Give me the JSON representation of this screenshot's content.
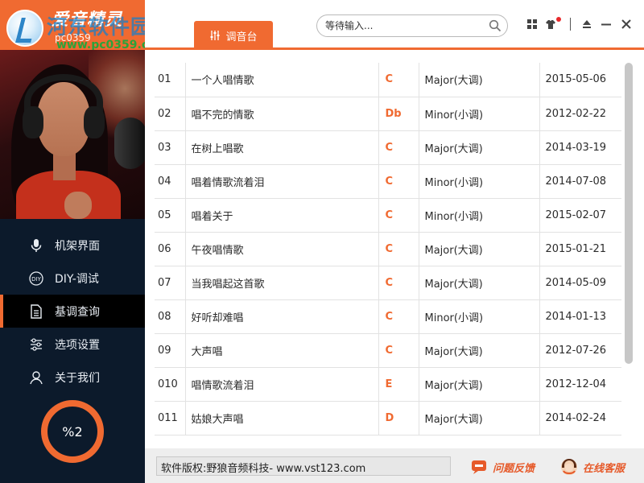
{
  "app": {
    "name": "爱音精灵",
    "watermark_title": "河东软件园",
    "watermark_code": "pc0359",
    "watermark_url": "www.pc0359.cn"
  },
  "sidebar": {
    "items": [
      {
        "label": "机架界面",
        "icon": "microphone-icon"
      },
      {
        "label": "DIY-调试",
        "icon": "diy-icon"
      },
      {
        "label": "基调查询",
        "icon": "document-icon",
        "active": true
      },
      {
        "label": "选项设置",
        "icon": "sliders-icon"
      },
      {
        "label": "关于我们",
        "icon": "user-icon"
      }
    ],
    "progress": {
      "text": "%2",
      "value": 0.02
    }
  },
  "header": {
    "tab": {
      "label": "调音台",
      "icon": "sliders-icon"
    },
    "search": {
      "placeholder": "等待输入...",
      "value": ""
    },
    "controls": [
      "grid-icon",
      "skin-icon",
      "eject-icon",
      "minimize-icon",
      "close-icon"
    ]
  },
  "songs": [
    {
      "num": "01",
      "title": "一个人唱情歌",
      "key": "C",
      "mode": "Major(大调)",
      "date": "2015-05-06"
    },
    {
      "num": "02",
      "title": "唱不完的情歌",
      "key": "Db",
      "mode": "Minor(小调)",
      "date": "2012-02-22"
    },
    {
      "num": "03",
      "title": "在树上唱歌",
      "key": "C",
      "mode": "Major(大调)",
      "date": "2014-03-19"
    },
    {
      "num": "04",
      "title": "唱着情歌流着泪",
      "key": "C",
      "mode": "Minor(小调)",
      "date": "2014-07-08"
    },
    {
      "num": "05",
      "title": "唱着关于",
      "key": "C",
      "mode": "Minor(小调)",
      "date": "2015-02-07"
    },
    {
      "num": "06",
      "title": "午夜唱情歌",
      "key": "C",
      "mode": "Major(大调)",
      "date": "2015-01-21"
    },
    {
      "num": "07",
      "title": "当我唱起这首歌",
      "key": "C",
      "mode": "Major(大调)",
      "date": "2014-05-09"
    },
    {
      "num": "08",
      "title": "好听却难唱",
      "key": "C",
      "mode": "Minor(小调)",
      "date": "2014-01-13"
    },
    {
      "num": "09",
      "title": "大声唱",
      "key": "C",
      "mode": "Major(大调)",
      "date": "2012-07-26"
    },
    {
      "num": "010",
      "title": "唱情歌流着泪",
      "key": "E",
      "mode": "Major(大调)",
      "date": "2012-12-04"
    },
    {
      "num": "011",
      "title": "姑娘大声唱",
      "key": "D",
      "mode": "Major(大调)",
      "date": "2014-02-24"
    }
  ],
  "footer": {
    "copyright": "软件版权:野狼音频科技- www.vst123.com",
    "feedback": "问题反馈",
    "support": "在线客服"
  },
  "colors": {
    "accent": "#f06a31",
    "sidebar_bg": "#0c1a2b",
    "key_text": "#f06a31"
  }
}
